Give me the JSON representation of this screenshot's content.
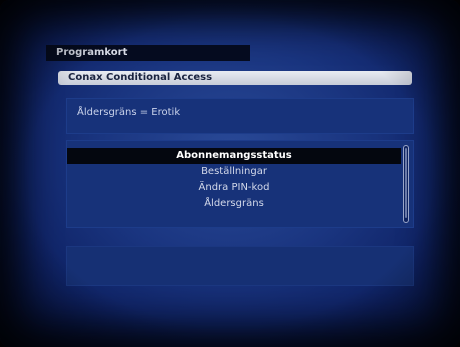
{
  "screen": {
    "title": "Programkort",
    "section_header": "Conax Conditional Access",
    "info_text": "Åldersgräns = Erotik",
    "menu": {
      "items": [
        {
          "label": "Abonnemangsstatus",
          "selected": true
        },
        {
          "label": "Beställningar",
          "selected": false
        },
        {
          "label": "Ändra PIN-kod",
          "selected": false
        },
        {
          "label": "Åldersgräns",
          "selected": false
        }
      ]
    }
  },
  "colors": {
    "background": "#1a3580",
    "panel": "#173279",
    "selection": "#04070f",
    "header_bar": "#e8ebf2"
  }
}
